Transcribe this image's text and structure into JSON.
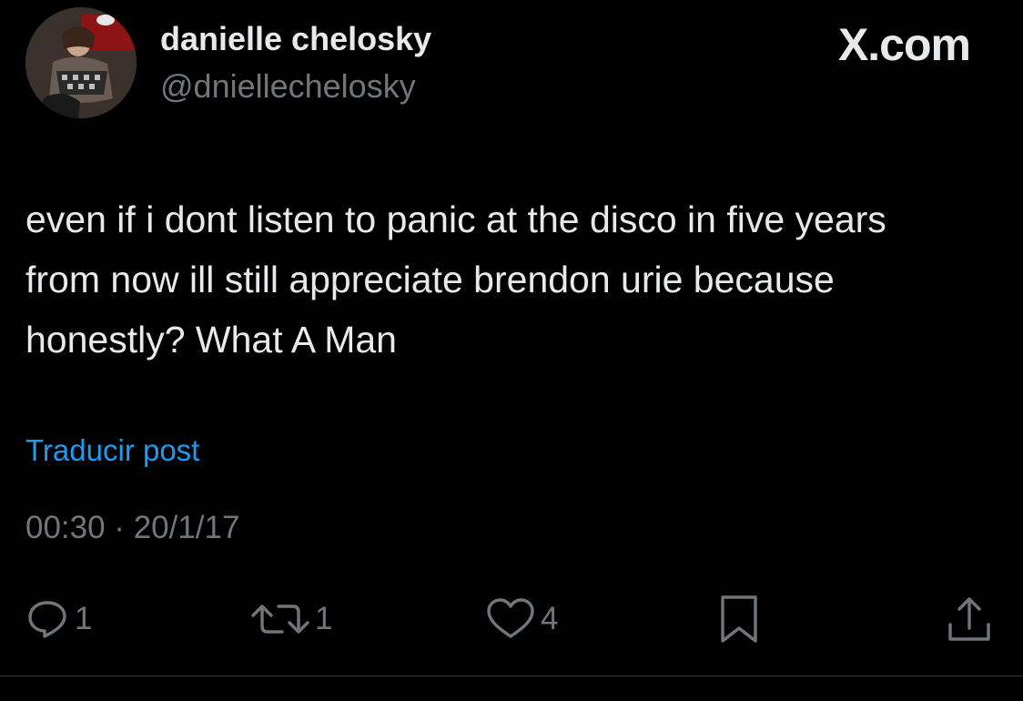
{
  "author": {
    "display_name": "danielle chelosky",
    "handle": "@dniellechelosky",
    "avatar_icon": "profile-photo"
  },
  "brand": "X.com",
  "post": {
    "text": "even if i dont listen to panic at the disco in five years from now ill still appreciate brendon urie because honestly? What A Man",
    "translate_label": "Traducir post",
    "timestamp": "00:30 · 20/1/17"
  },
  "actions": {
    "reply": {
      "icon": "reply-icon",
      "count": "1"
    },
    "repost": {
      "icon": "repost-icon",
      "count": "1"
    },
    "like": {
      "icon": "heart-icon",
      "count": "4"
    },
    "bookmark": {
      "icon": "bookmark-icon"
    },
    "share": {
      "icon": "share-icon"
    }
  },
  "colors": {
    "background": "#000000",
    "primary_text": "#e7e9ea",
    "secondary_text": "#71767b",
    "link": "#1d9bf0",
    "divider": "#2f3336"
  }
}
